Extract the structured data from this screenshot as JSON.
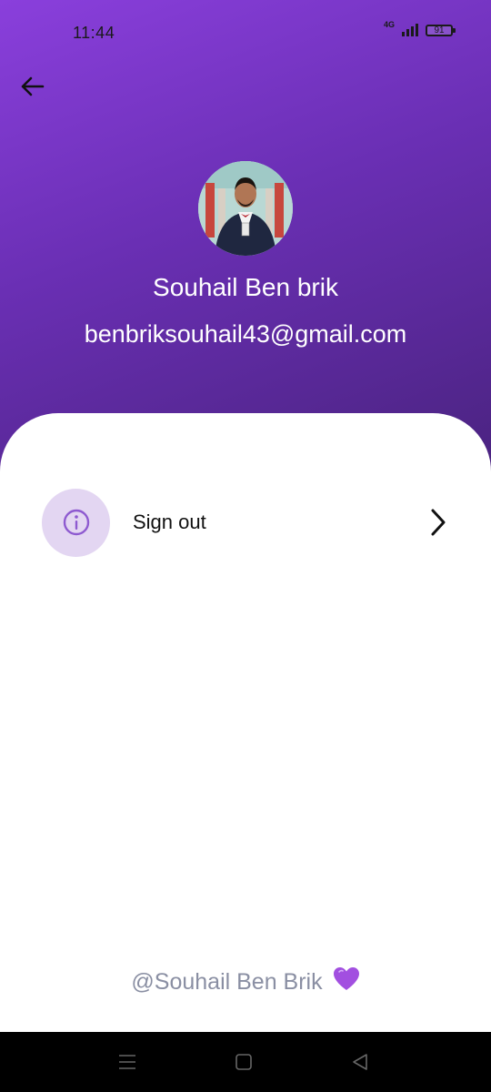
{
  "status_bar": {
    "time": "11:44",
    "network": "4G",
    "battery": "91"
  },
  "profile": {
    "name": "Souhail Ben brik",
    "email": "benbriksouhail43@gmail.com"
  },
  "menu": {
    "sign_out_label": "Sign out"
  },
  "footer": {
    "credit": "@Souhail Ben Brik"
  },
  "colors": {
    "header_start": "#8a3fdc",
    "header_end": "#4a2380",
    "icon_bg": "#e3d6f2",
    "icon_fg": "#8e5ad0",
    "footer_text": "#8a8fa3"
  },
  "icons": {
    "back": "arrow-left-icon",
    "sign_out": "info-icon",
    "row_chevron": "chevron-right-icon",
    "footer_heart": "purple-heart-icon"
  }
}
